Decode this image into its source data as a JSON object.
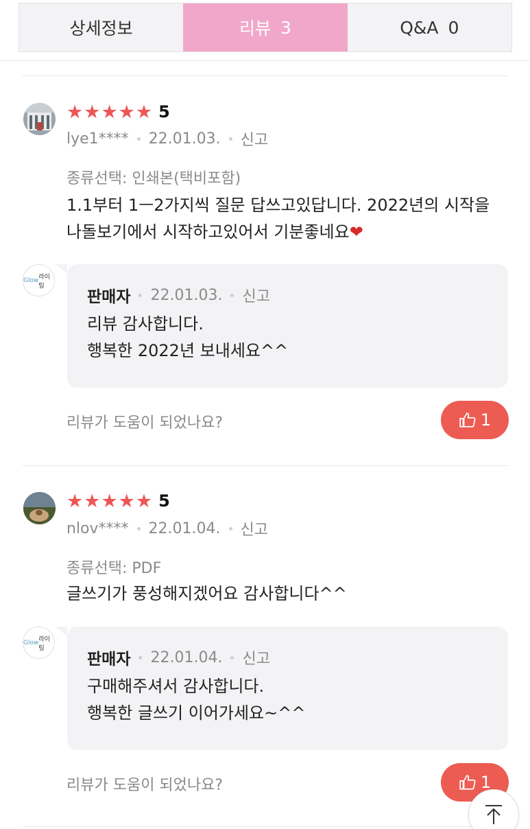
{
  "tabs": [
    {
      "label": "상세정보",
      "count": ""
    },
    {
      "label": "리뷰",
      "count": "3"
    },
    {
      "label": "Q&A",
      "count": "0"
    }
  ],
  "active_tab": 1,
  "reviews": [
    {
      "rating": 5,
      "score_label": "5",
      "user": "lye1****",
      "date": "22.01.03.",
      "report": "신고",
      "option": "종류선택: 인쇄본(택비포함)",
      "body": "1.1부터 1ㅡ2가지씩 질문 답쓰고있답니다. 2022년의 시작을 나돌보기에서 시작하고있어서 기분좋네요",
      "body_icon": "heart-emoji",
      "reply": {
        "author": "판매자",
        "date": "22.01.03.",
        "report": "신고",
        "lines": [
          "리뷰 감사합니다.",
          "행복한 2022년 보내세요^^"
        ]
      },
      "helpful_prompt": "리뷰가 도움이 되었나요?",
      "likes": "1"
    },
    {
      "rating": 5,
      "score_label": "5",
      "user": "nlov****",
      "date": "22.01.04.",
      "report": "신고",
      "option": "종류선택: PDF",
      "body": "글쓰기가 풍성해지겠어요 감사합니다^^",
      "reply": {
        "author": "판매자",
        "date": "22.01.04.",
        "report": "신고",
        "lines": [
          "구매해주셔서 감사합니다.",
          "행복한 글쓰기 이어가세요~^^"
        ]
      },
      "helpful_prompt": "리뷰가 도움이 되었나요?",
      "likes": "1"
    }
  ],
  "seller_logo": {
    "brand": "Glow",
    "suffix": "라이팅"
  },
  "colors": {
    "accent_pink": "#f1a7c9",
    "star_red": "#ee5656",
    "like_red": "#ec5c52"
  },
  "icons": {
    "like": "thumbs-up-icon",
    "scroll_top": "arrow-up-icon",
    "star": "star-icon"
  }
}
